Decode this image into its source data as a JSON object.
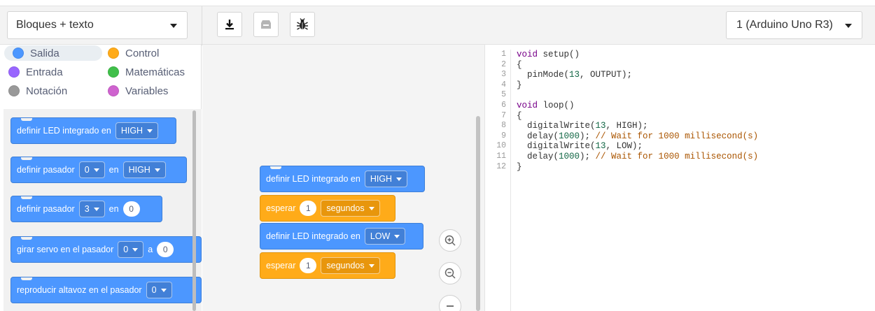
{
  "toolbar": {
    "mode_select": "Bloques + texto",
    "board_select": "1 (Arduino Uno R3)",
    "buttons": [
      {
        "icon": "download-icon"
      },
      {
        "icon": "upload-icon"
      },
      {
        "icon": "bug-icon"
      }
    ]
  },
  "categories": [
    {
      "label": "Salida",
      "color": "#4c97ff",
      "selected": true
    },
    {
      "label": "Control",
      "color": "#ffab19"
    },
    {
      "label": "Entrada",
      "color": "#9966ff"
    },
    {
      "label": "Matemáticas",
      "color": "#40bf4a"
    },
    {
      "label": "Notación",
      "color": "#999999"
    },
    {
      "label": "Variables",
      "color": "#cf63cf"
    }
  ],
  "palette_blocks": [
    {
      "text": "definir LED integrado en",
      "dropdown": "HIGH"
    },
    {
      "text": "definir pasador",
      "dropdown1": "0",
      "text2": "en",
      "dropdown2": "HIGH"
    },
    {
      "text": "definir pasador",
      "dropdown1": "3",
      "text2": "en",
      "input": "0"
    },
    {
      "text": "girar servo en el pasador",
      "dropdown1": "0",
      "text2": "a",
      "input": "0"
    },
    {
      "text": "reproducir altavoz en el pasador",
      "dropdown1": "0"
    }
  ],
  "workspace_blocks": [
    {
      "text": "definir LED integrado en",
      "dropdown": "HIGH"
    },
    {
      "text": "esperar",
      "input": "1",
      "dropdown": "segundos"
    },
    {
      "text": "definir LED integrado en",
      "dropdown": "LOW"
    },
    {
      "text": "esperar",
      "input": "1",
      "dropdown": "segundos"
    }
  ],
  "zoom_controls": [
    "zoom-in-icon",
    "zoom-out-icon",
    "zoom-reset-icon"
  ],
  "code": {
    "line_numbers": [
      "1",
      "2",
      "3",
      "4",
      "5",
      "6",
      "7",
      "8",
      "9",
      "10",
      "11",
      "12"
    ],
    "lines": [
      [
        {
          "t": "void",
          "c": "kw"
        },
        {
          "t": " setup()"
        }
      ],
      [
        {
          "t": "{"
        }
      ],
      [
        {
          "t": "  pinMode("
        },
        {
          "t": "13",
          "c": "nm"
        },
        {
          "t": ", OUTPUT);"
        }
      ],
      [
        {
          "t": "}"
        }
      ],
      [
        {
          "t": ""
        }
      ],
      [
        {
          "t": "void",
          "c": "kw"
        },
        {
          "t": " loop()"
        }
      ],
      [
        {
          "t": "{"
        }
      ],
      [
        {
          "t": "  digitalWrite("
        },
        {
          "t": "13",
          "c": "nm"
        },
        {
          "t": ", HIGH);"
        }
      ],
      [
        {
          "t": "  delay("
        },
        {
          "t": "1000",
          "c": "nm"
        },
        {
          "t": "); "
        },
        {
          "t": "// Wait for 1000 millisecond(s)",
          "c": "cm"
        }
      ],
      [
        {
          "t": "  digitalWrite("
        },
        {
          "t": "13",
          "c": "nm"
        },
        {
          "t": ", LOW);"
        }
      ],
      [
        {
          "t": "  delay("
        },
        {
          "t": "1000",
          "c": "nm"
        },
        {
          "t": "); "
        },
        {
          "t": "// Wait for 1000 millisecond(s)",
          "c": "cm"
        }
      ],
      [
        {
          "t": "}"
        }
      ]
    ]
  }
}
